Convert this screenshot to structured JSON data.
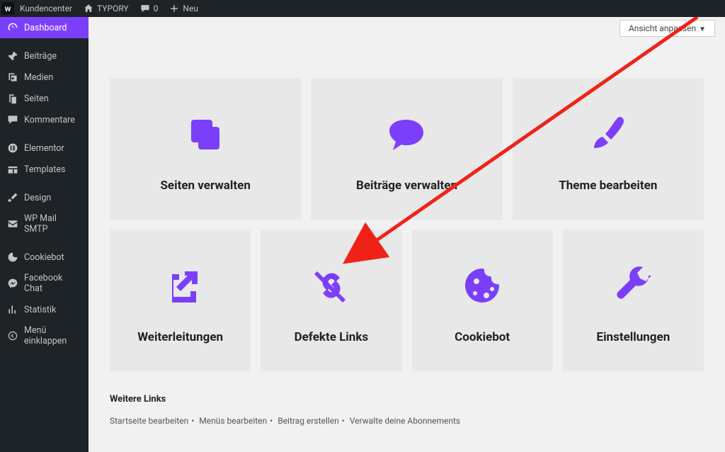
{
  "topbar": {
    "kundencenter": "Kundencenter",
    "site": "TYPORY",
    "comments": "0",
    "neu": "Neu"
  },
  "sidebar": {
    "dashboard": "Dashboard",
    "beitraege": "Beiträge",
    "medien": "Medien",
    "seiten": "Seiten",
    "kommentare": "Kommentare",
    "elementor": "Elementor",
    "templates": "Templates",
    "design": "Design",
    "wpmail": "WP Mail SMTP",
    "cookiebot": "Cookiebot",
    "facebook": "Facebook Chat",
    "statistik": "Statistik",
    "collapse": "Menü einklappen"
  },
  "screen_options": "Ansicht anpassen",
  "tiles": {
    "seiten_verwalten": "Seiten verwalten",
    "beitraege_verwalten": "Beiträge verwalten",
    "theme_bearbeiten": "Theme bearbeiten",
    "weiterleitungen": "Weiterleitungen",
    "defekte_links": "Defekte Links",
    "cookiebot": "Cookiebot",
    "einstellungen": "Einstellungen"
  },
  "further": {
    "heading": "Weitere Links",
    "links": [
      "Startseite bearbeiten",
      "Menüs bearbeiten",
      "Beitrag erstellen",
      "Verwalte deine Abonnements"
    ]
  }
}
